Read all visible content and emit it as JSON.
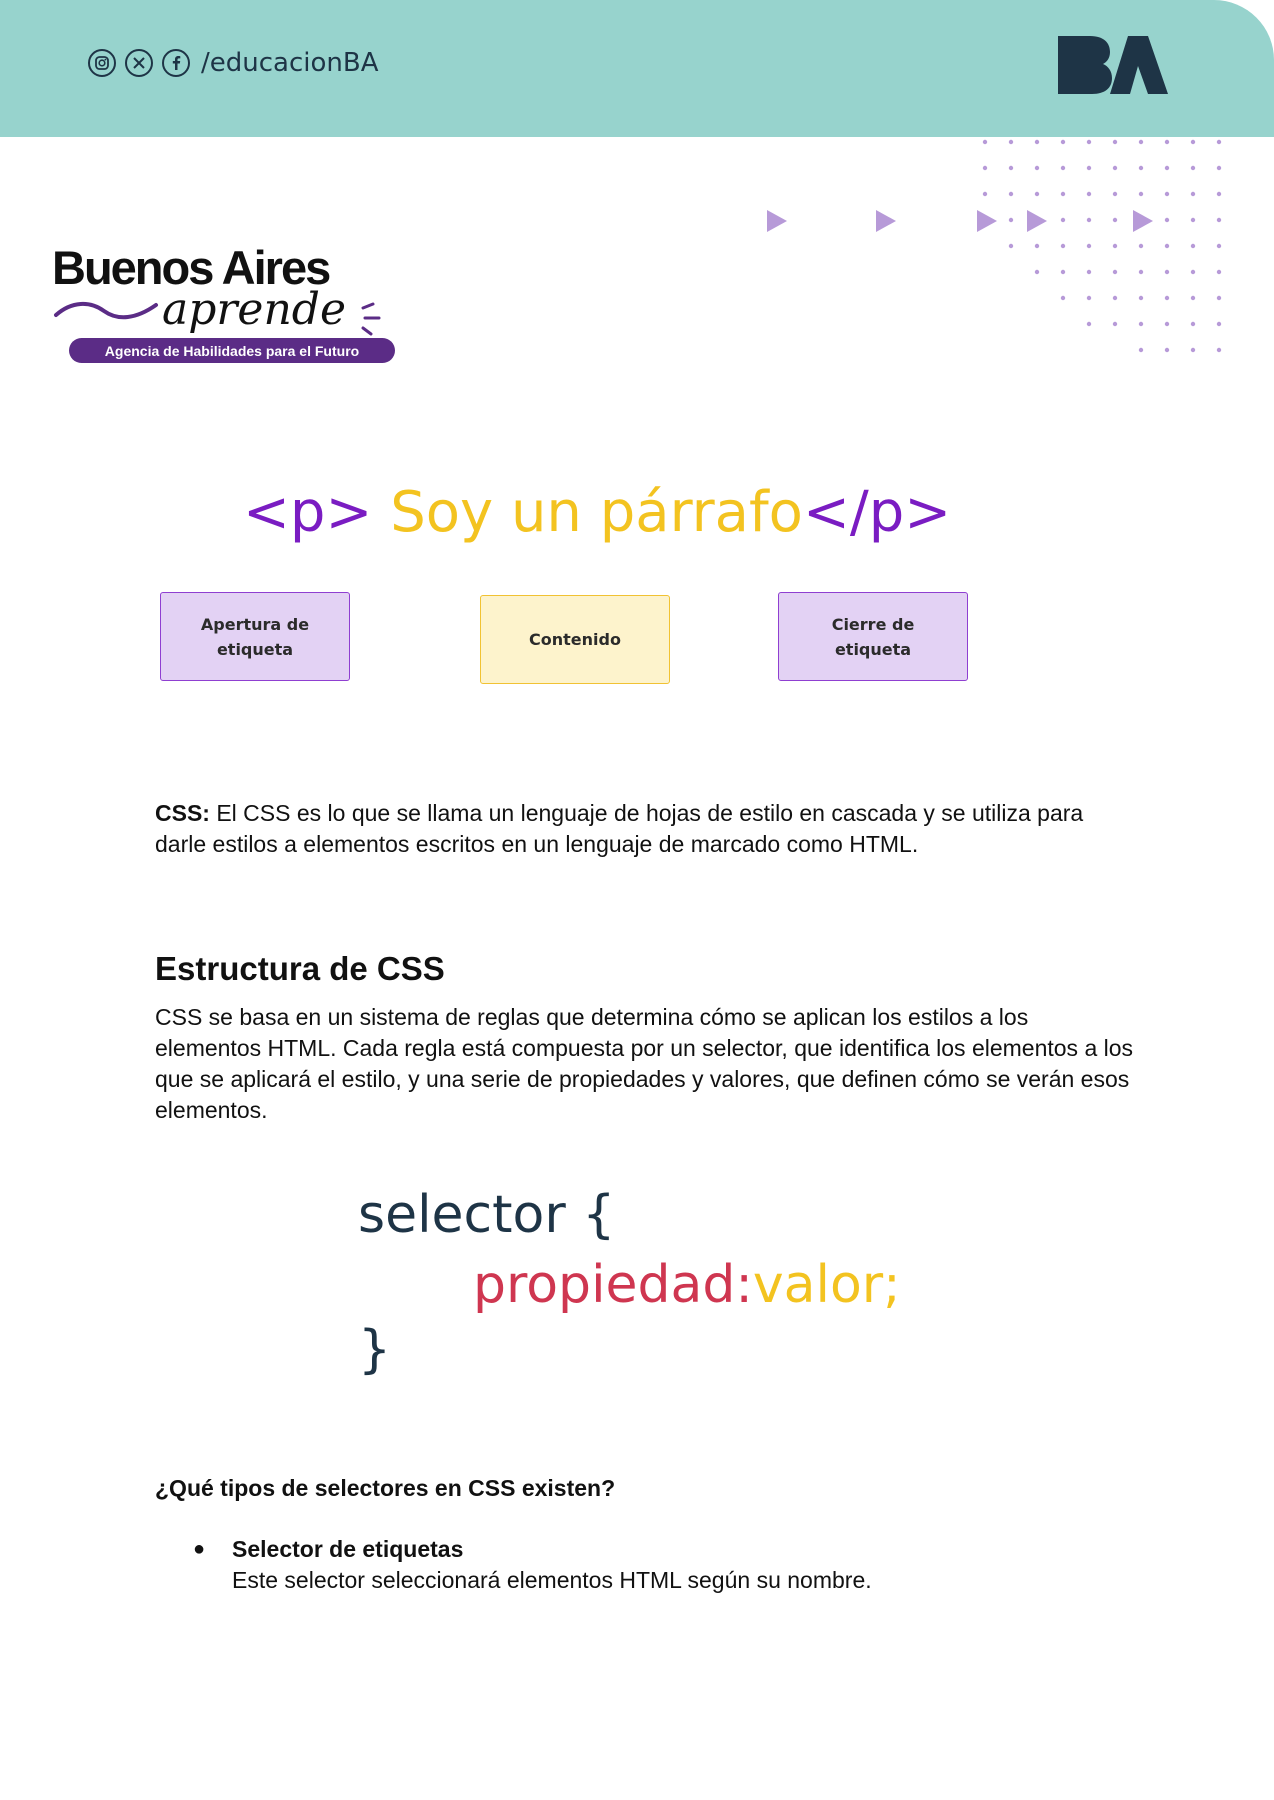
{
  "header": {
    "social_icons": [
      "instagram-icon",
      "x-icon",
      "facebook-icon"
    ],
    "handle": "/educacionBA",
    "logo_text": "BA",
    "background_color": "#97d3cd"
  },
  "brand": {
    "title": "Buenos Aires",
    "subtitle": "aprende",
    "tagline": "Agencia de Habilidades para el Futuro"
  },
  "html_example": {
    "open_tag": "<p>",
    "content": " Soy un párrafo",
    "close_tag": "</p>"
  },
  "boxes": {
    "open": "Apertura de etiqueta",
    "content": "Contenido",
    "close": "Cierre de etiqueta"
  },
  "css_definition": {
    "label": "CSS:",
    "text": " El CSS es lo que se llama un lenguaje de hojas de estilo en cascada y se utiliza para darle estilos a elementos escritos en un lenguaje de marcado como HTML."
  },
  "structure": {
    "heading": "Estructura de CSS",
    "body": "CSS se basa en un sistema de reglas que determina cómo se aplican los estilos a los elementos HTML. Cada regla está compuesta por un selector, que identifica los elementos a los que se aplicará el estilo, y una serie de propiedades y valores, que definen cómo se verán esos elementos."
  },
  "css_syntax": {
    "selector_line": "selector {",
    "property": "propiedad:",
    "value": "valor;",
    "close": "}"
  },
  "selectors": {
    "question": "¿Qué tipos de selectores en CSS existen?",
    "items": [
      {
        "bullet": "●",
        "title": "Selector de etiquetas",
        "description": "Este selector seleccionará elementos HTML según su nombre."
      }
    ]
  },
  "colors": {
    "tag_purple": "#7a1cc2",
    "content_yellow": "#f3c320",
    "selector_navy": "#1e3446",
    "property_red": "#cf3650"
  }
}
